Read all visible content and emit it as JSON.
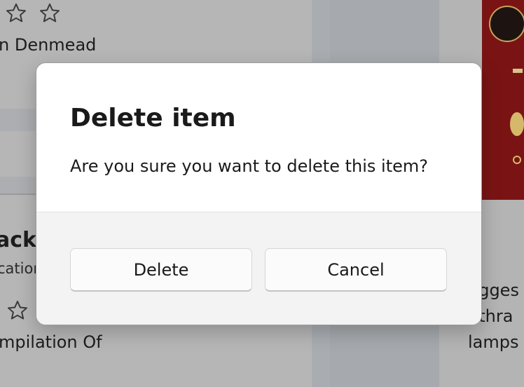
{
  "background": {
    "top_left_author": "n Denmead",
    "mid_left_title": "acks",
    "mid_left_subtitle": "cation",
    "bottom_left_text": "mpilation Of",
    "right_lines": [
      "ugges",
      "nthra",
      "lamps"
    ],
    "star_icon": "star-outline-icon"
  },
  "dialog": {
    "title": "Delete item",
    "message": "Are you sure you want to delete this item?",
    "primary_button": "Delete",
    "secondary_button": "Cancel"
  }
}
